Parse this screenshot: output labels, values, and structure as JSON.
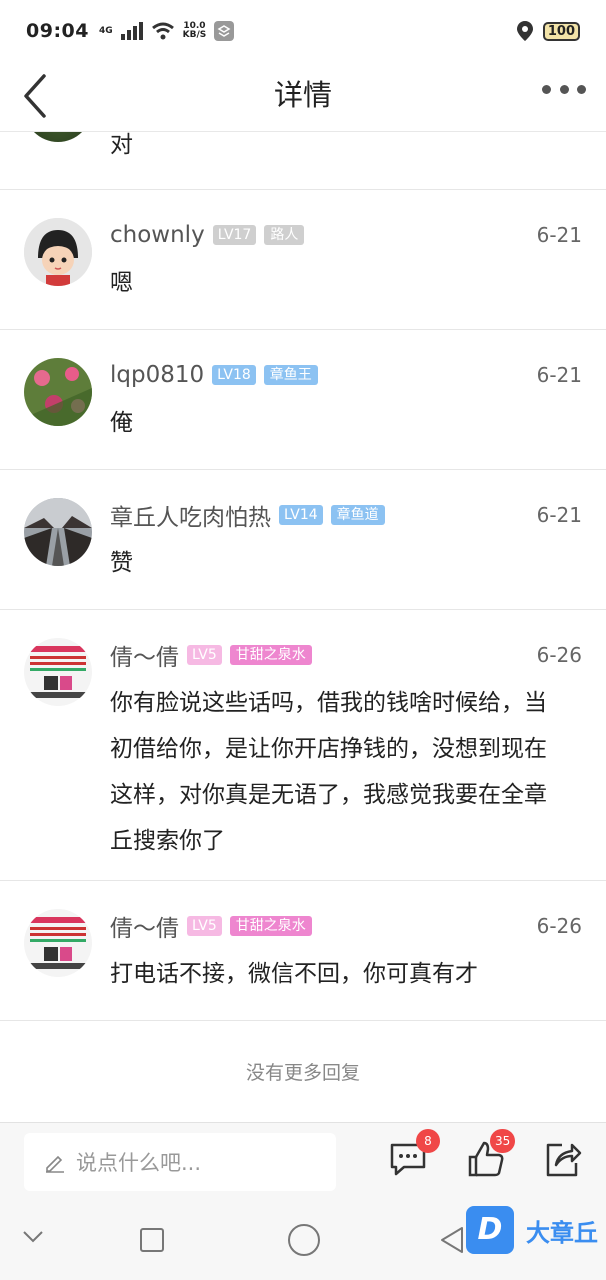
{
  "status": {
    "time": "09:04",
    "net_top": "4G",
    "speed_top": "10.0",
    "speed_bottom": "KB/S",
    "battery": "100"
  },
  "header": {
    "title": "详情"
  },
  "comments": [
    {
      "text": "对"
    },
    {
      "name": "chownly",
      "level": "LV17",
      "tag": "路人",
      "date": "6-21",
      "text": "嗯"
    },
    {
      "name": "lqp0810",
      "level": "LV18",
      "tag": "章鱼王",
      "date": "6-21",
      "text": "俺"
    },
    {
      "name": "章丘人吃肉怕热",
      "level": "LV14",
      "tag": "章鱼道",
      "date": "6-21",
      "text": "赞"
    },
    {
      "name": "倩〜倩",
      "level": "LV5",
      "tag": "甘甜之泉水",
      "date": "6-26",
      "text": "你有脸说这些话吗，借我的钱啥时候给，当初借给你，是让你开店挣钱的，没想到现在这样，对你真是无语了，我感觉我要在全章丘搜索你了"
    },
    {
      "name": "倩〜倩",
      "level": "LV5",
      "tag": "甘甜之泉水",
      "date": "6-26",
      "text": "打电话不接，微信不回，你可真有才"
    }
  ],
  "list_footer": "没有更多回复",
  "bottom_bar": {
    "input_placeholder": "说点什么吧...",
    "comment_count": "8",
    "like_count": "35"
  },
  "watermark": {
    "letter": "D",
    "text": "大章丘"
  }
}
